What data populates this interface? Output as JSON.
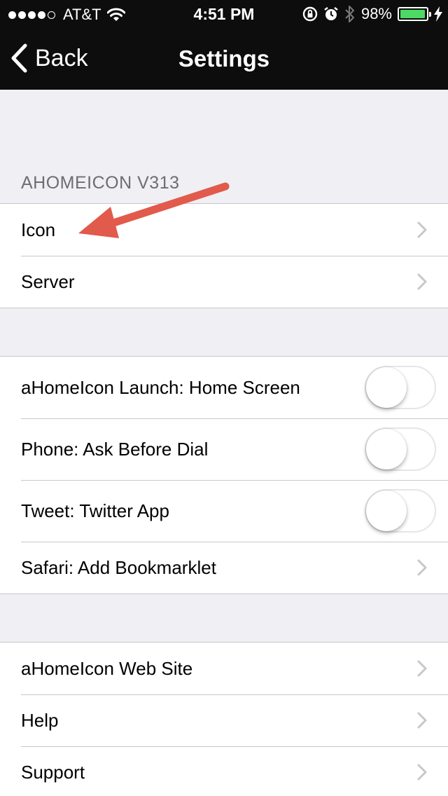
{
  "status_bar": {
    "carrier": "AT&T",
    "time": "4:51 PM",
    "battery_percent": "98%",
    "battery_level": 0.98,
    "icons": [
      "signal-dots",
      "wifi-icon",
      "rotation-lock-icon",
      "alarm-icon",
      "bluetooth-icon",
      "battery-icon",
      "charging-bolt-icon"
    ]
  },
  "nav": {
    "back_label": "Back",
    "title": "Settings"
  },
  "section1": {
    "header": "AHOMEICON V313",
    "rows": [
      {
        "label": "Icon"
      },
      {
        "label": "Server"
      }
    ]
  },
  "section2": {
    "rows": [
      {
        "label": "aHomeIcon Launch: Home Screen",
        "toggle": false
      },
      {
        "label": "Phone: Ask Before Dial",
        "toggle": false
      },
      {
        "label": "Tweet: Twitter App",
        "toggle": false
      },
      {
        "label": "Safari: Add Bookmarklet"
      }
    ]
  },
  "section3": {
    "rows": [
      {
        "label": "aHomeIcon Web Site"
      },
      {
        "label": "Help"
      },
      {
        "label": "Support"
      }
    ]
  },
  "colors": {
    "annotation_arrow": "#e15a4b",
    "battery_fill": "#4cd964",
    "background": "#efeff4"
  }
}
